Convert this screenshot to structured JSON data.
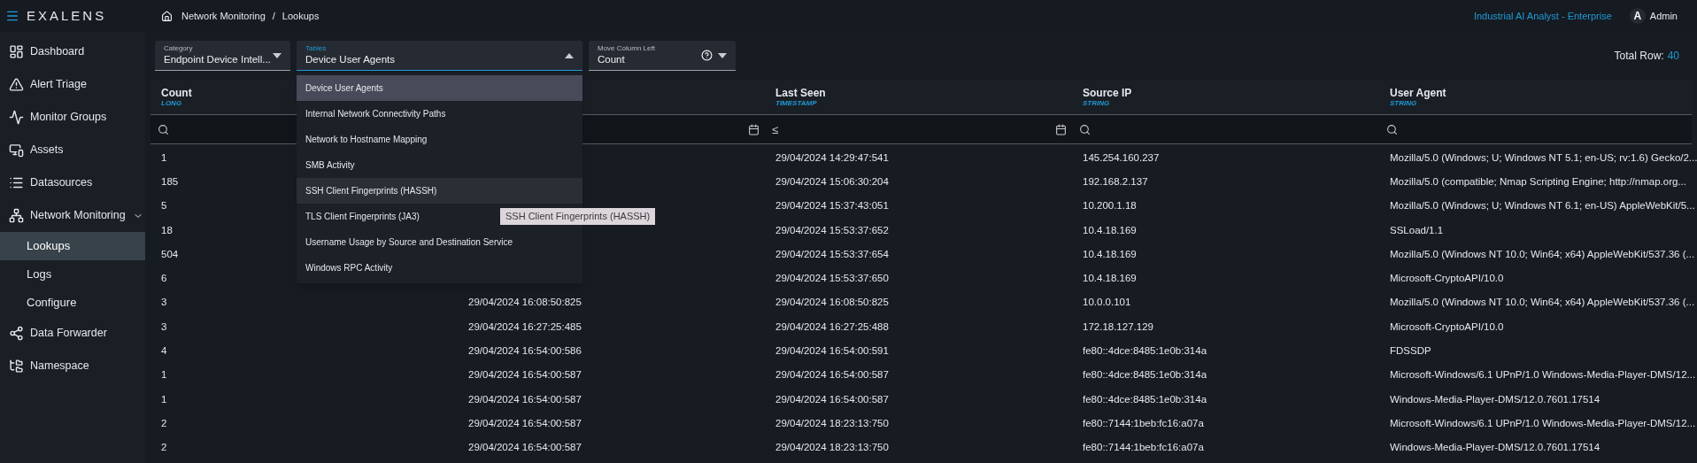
{
  "header": {
    "logo": "EXALENS",
    "breadcrumb": [
      "Network Monitoring",
      "Lookups"
    ],
    "breadcrumb_separator": "/",
    "product": "Industrial AI Analyst - Enterprise",
    "avatar": "A",
    "user": "Admin"
  },
  "sidebar": {
    "items": [
      {
        "label": "Dashboard",
        "kind": "dashboard",
        "selected": false
      },
      {
        "label": "Alert Triage",
        "kind": "alert",
        "selected": false
      },
      {
        "label": "Monitor Groups",
        "kind": "monitor",
        "selected": false
      },
      {
        "label": "Assets",
        "kind": "assets",
        "selected": false
      },
      {
        "label": "Datasources",
        "kind": "datasources",
        "selected": false
      },
      {
        "label": "Network Monitoring",
        "kind": "network",
        "selected": false,
        "expanded": true,
        "children": [
          {
            "label": "Lookups",
            "selected": true
          },
          {
            "label": "Logs",
            "selected": false
          },
          {
            "label": "Configure",
            "selected": false
          }
        ]
      },
      {
        "label": "Data Forwarder",
        "kind": "forwarder",
        "selected": false
      },
      {
        "label": "Namespace",
        "kind": "namespace",
        "selected": false
      }
    ]
  },
  "toolbar": {
    "category": {
      "label": "Category",
      "value": "Endpoint Device Intell..."
    },
    "tables": {
      "label": "Tables",
      "value": "Device User Agents",
      "open": true,
      "options": [
        {
          "label": "Device User Agents",
          "selected": true,
          "hovered": false
        },
        {
          "label": "Internal Network Connectivity Paths",
          "selected": false,
          "hovered": false
        },
        {
          "label": "Network to Hostname Mapping",
          "selected": false,
          "hovered": false
        },
        {
          "label": "SMB Activity",
          "selected": false,
          "hovered": false
        },
        {
          "label": "SSH Client Fingerprints (HASSH)",
          "selected": false,
          "hovered": true
        },
        {
          "label": "TLS Client Fingerprints (JA3)",
          "selected": false,
          "hovered": false
        },
        {
          "label": "Username Usage by Source and Destination Service",
          "selected": false,
          "hovered": false
        },
        {
          "label": "Windows RPC Activity",
          "selected": false,
          "hovered": false
        }
      ],
      "tooltip": "SSH Client Fingerprints (HASSH)"
    },
    "move_column": {
      "label": "Move Column Left",
      "value": "Count"
    },
    "total_label": "Total Row:",
    "total": "40"
  },
  "table": {
    "columns": [
      {
        "name": "Count",
        "type": "LONG",
        "kind": "search"
      },
      {
        "kind": "date"
      },
      {
        "name": "Last Seen",
        "type": "TIMESTAMP",
        "kind": "date",
        "operator": "≤"
      },
      {
        "name": "Source IP",
        "type": "STRING",
        "kind": "search"
      },
      {
        "name": "User Agent",
        "type": "STRING",
        "kind": "search"
      }
    ],
    "rows": [
      {
        "count": "1",
        "last_seen": "29/04/2024 14:29:47:541",
        "source_ip": "145.254.160.237",
        "user_agent": "Mozilla/5.0 (Windows; U; Windows NT 5.1; en-US; rv:1.6) Gecko/2..."
      },
      {
        "count": "185",
        "last_seen": "29/04/2024 15:06:30:204",
        "source_ip": "192.168.2.137",
        "user_agent": "Mozilla/5.0 (compatible; Nmap Scripting Engine; http://nmap.org..."
      },
      {
        "count": "5",
        "last_seen": "29/04/2024 15:37:43:051",
        "source_ip": "10.200.1.18",
        "user_agent": "Mozilla/5.0 (Windows; U; Windows NT 6.1; en-US) AppleWebKit/5..."
      },
      {
        "count": "18",
        "last_seen": "29/04/2024 15:53:37:652",
        "source_ip": "10.4.18.169",
        "user_agent": "SSLoad/1.1"
      },
      {
        "count": "504",
        "last_seen": "29/04/2024 15:53:37:654",
        "source_ip": "10.4.18.169",
        "user_agent": "Mozilla/5.0 (Windows NT 10.0; Win64; x64) AppleWebKit/537.36 (..."
      },
      {
        "count": "6",
        "last_seen": "29/04/2024 15:53:37:650",
        "source_ip": "10.4.18.169",
        "user_agent": "Microsoft-CryptoAPI/10.0"
      },
      {
        "count": "3",
        "column_2": "29/04/2024 16:08:50:825",
        "last_seen": "29/04/2024 16:08:50:825",
        "source_ip": "10.0.0.101",
        "user_agent": "Mozilla/5.0 (Windows NT 10.0; Win64; x64) AppleWebKit/537.36 (..."
      },
      {
        "count": "3",
        "column_2": "29/04/2024 16:27:25:485",
        "last_seen": "29/04/2024 16:27:25:488",
        "source_ip": "172.18.127.129",
        "user_agent": "Microsoft-CryptoAPI/10.0"
      },
      {
        "count": "4",
        "column_2": "29/04/2024 16:54:00:586",
        "last_seen": "29/04/2024 16:54:00:591",
        "source_ip": "fe80::4dce:8485:1e0b:314a",
        "user_agent": "FDSSDP"
      },
      {
        "count": "1",
        "column_2": "29/04/2024 16:54:00:587",
        "last_seen": "29/04/2024 16:54:00:587",
        "source_ip": "fe80::4dce:8485:1e0b:314a",
        "user_agent": "Microsoft-Windows/6.1 UPnP/1.0 Windows-Media-Player-DMS/12..."
      },
      {
        "count": "1",
        "column_2": "29/04/2024 16:54:00:587",
        "last_seen": "29/04/2024 16:54:00:587",
        "source_ip": "fe80::4dce:8485:1e0b:314a",
        "user_agent": "Windows-Media-Player-DMS/12.0.7601.17514"
      },
      {
        "count": "2",
        "column_2": "29/04/2024 16:54:00:587",
        "last_seen": "29/04/2024 18:23:13:750",
        "source_ip": "fe80::7144:1beb:fc16:a07a",
        "user_agent": "Microsoft-Windows/6.1 UPnP/1.0 Windows-Media-Player-DMS/12..."
      },
      {
        "count": "2",
        "column_2": "29/04/2024 16:54:00:587",
        "last_seen": "29/04/2024 18:23:13:750",
        "source_ip": "fe80::7144:1beb:fc16:a07a",
        "user_agent": "Windows-Media-Player-DMS/12.0.7601.17514"
      }
    ]
  }
}
